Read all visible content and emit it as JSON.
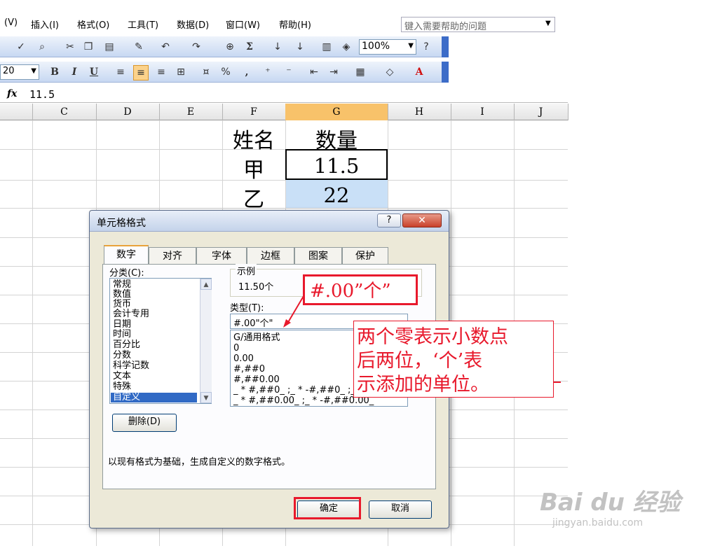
{
  "menu": {
    "items": [
      "(V)",
      "插入(I)",
      "格式(O)",
      "工具(T)",
      "数据(D)",
      "窗口(W)",
      "帮助(H)"
    ],
    "help_placeholder": "键入需要帮助的问题"
  },
  "toolbar": {
    "zoom": "100%",
    "font_size": "20",
    "icons": [
      "bold-icon",
      "italic-icon",
      "underline-icon",
      "align-left-icon",
      "align-center-icon",
      "align-right-icon",
      "merge-center-icon",
      "currency-icon",
      "percent-icon",
      "comma-icon",
      "increase-decimal-icon",
      "decrease-decimal-icon",
      "decrease-indent-icon",
      "increase-indent-icon",
      "borders-icon",
      "fill-color-icon",
      "font-color-icon"
    ],
    "labels": {
      "bold": "B",
      "italic": "I",
      "underline": "U",
      "percent": "%",
      "comma": ",",
      "sum": "Σ",
      "font_color": "A"
    }
  },
  "formula_bar": {
    "fx": "fx",
    "value": "11.5"
  },
  "sheet": {
    "columns": [
      "C",
      "D",
      "E",
      "F",
      "G",
      "H",
      "I",
      "J"
    ],
    "selected_column": "G",
    "cells": {
      "f_header": "姓名",
      "g_header": "数量",
      "f_row1": "甲",
      "g_row1": "11.5",
      "f_row2": "乙",
      "g_row2": "22"
    }
  },
  "dialog": {
    "title": "单元格格式",
    "help": "?",
    "close": "✕",
    "tabs": [
      "数字",
      "对齐",
      "字体",
      "边框",
      "图案",
      "保护"
    ],
    "active_tab": "数字",
    "category_label": "分类(C):",
    "categories": [
      "常规",
      "数值",
      "货币",
      "会计专用",
      "日期",
      "时间",
      "百分比",
      "分数",
      "科学记数",
      "文本",
      "特殊",
      "自定义"
    ],
    "selected_category": "自定义",
    "sample_label": "示例",
    "sample_value": "11.50个",
    "type_label": "类型(T):",
    "type_value": "#.00\"个\"",
    "type_options": [
      "G/通用格式",
      "0",
      "0.00",
      "#,##0",
      "#,##0.00",
      "_ * #,##0_ ;_ * -#,##0_ ;_ *",
      "_ * #,##0.00_ ;_ * -#,##0.00_"
    ],
    "delete_button": "删除(D)",
    "description": "以现有格式为基础，生成自定义的数字格式。",
    "ok_button": "确定",
    "cancel_button": "取消"
  },
  "annotations": {
    "format_code": "#.00”个”",
    "explanation_lines": [
      "两个零表示小数点",
      "后两位，‘个’表",
      "示添加的单位。"
    ]
  },
  "watermark": {
    "brand": "Bai du 经验",
    "url": "jingyan.baidu.com"
  },
  "colors": {
    "accent_red": "#e8192c",
    "selection_blue": "#316ac5",
    "column_highlight": "#f8c26a",
    "cell_highlight": "#c9e0f7"
  }
}
